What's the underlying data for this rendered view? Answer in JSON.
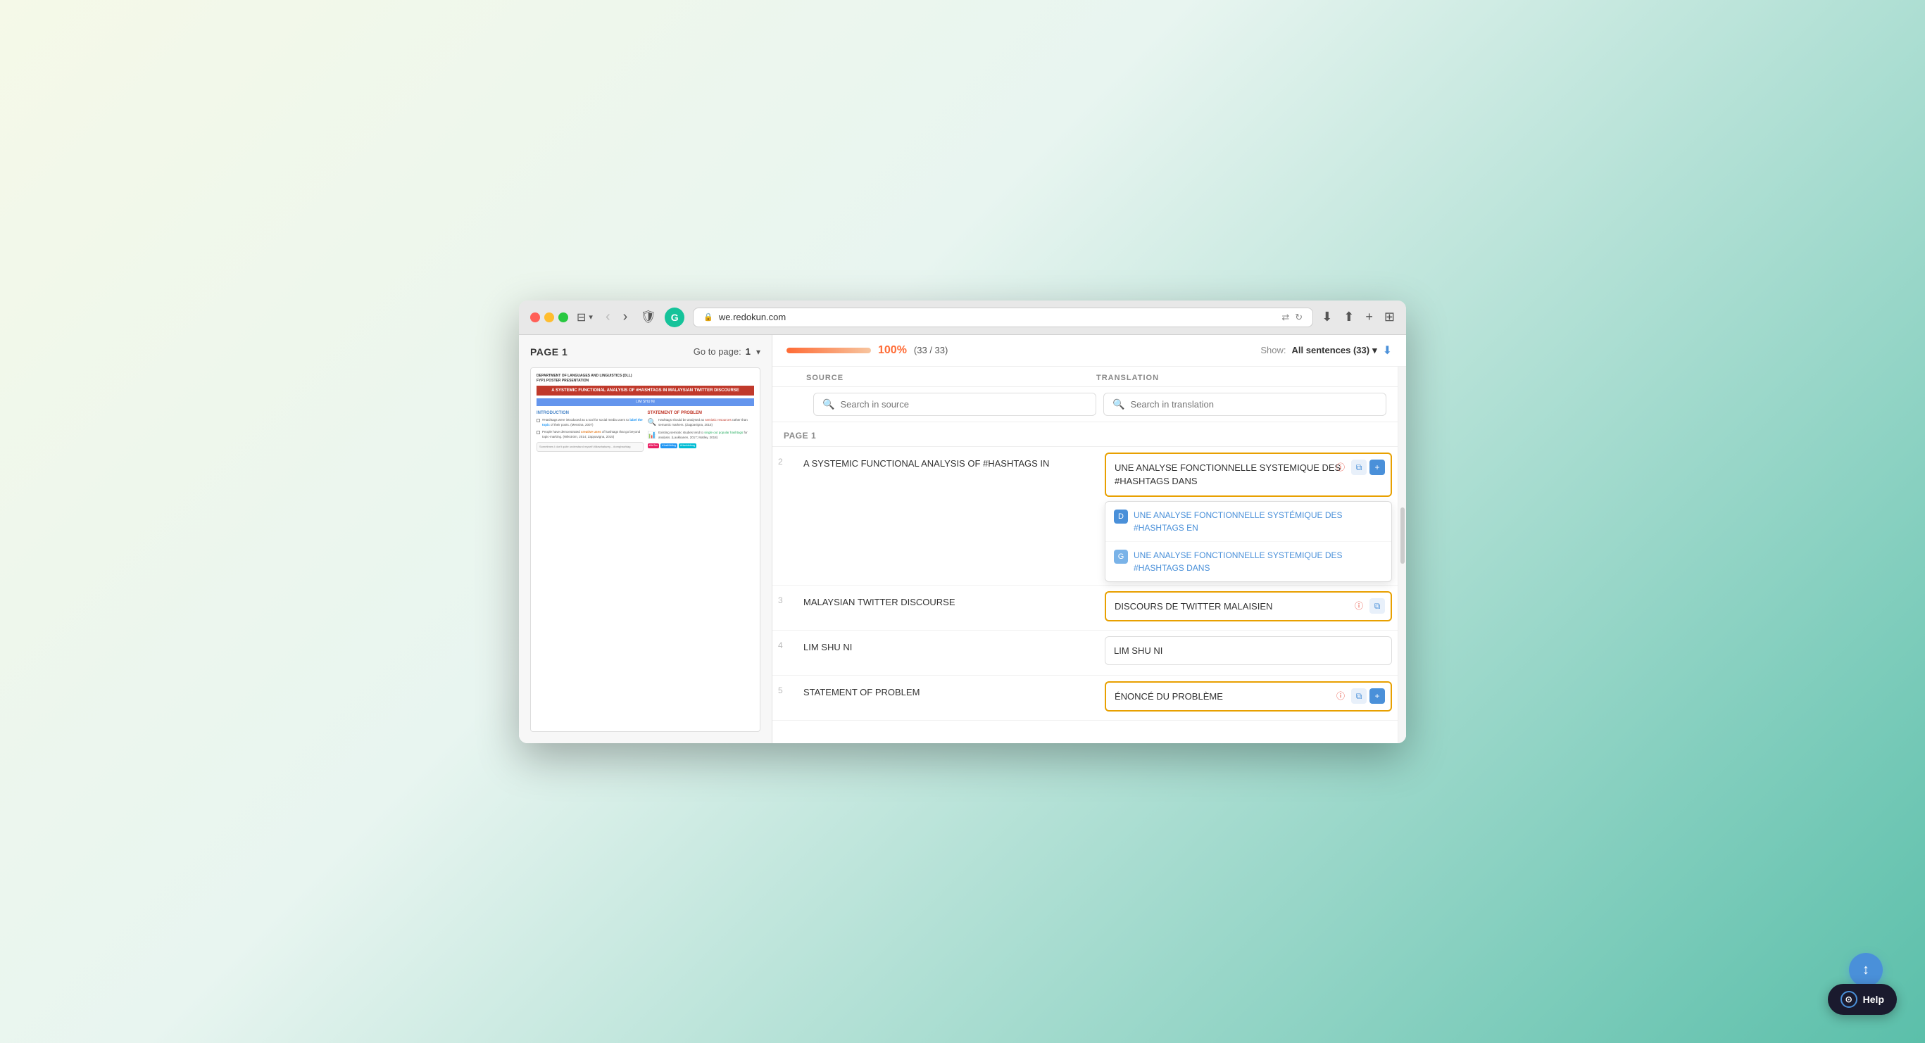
{
  "browser": {
    "url": "we.redokun.com",
    "tab_icon": "G",
    "shield": "shield-icon",
    "grammarly": "G",
    "nav_back": "‹",
    "nav_forward": "›",
    "lock_icon": "🔒",
    "translate_icon": "⇄",
    "refresh_icon": "↻",
    "download_icon": "↓",
    "share_icon": "↑",
    "add_tab_icon": "+",
    "grid_icon": "⊞"
  },
  "sidebar": {
    "page_title": "PAGE 1",
    "goto_label": "Go to page:",
    "page_number": "1",
    "doc": {
      "dept": "DEPARTMENT OF LANGUAGES AND LINGUISTICS (DLL)",
      "subtitle": "FYP1 POSTER PRESENTATION",
      "title": "A SYSTEMIC FUNCTIONAL ANALYSIS OF #HASHTAGS IN MALAYSIAN TWITTER DISCOURSE",
      "author": "LIM SHU NI",
      "intro_title": "INTRODUCTION",
      "problem_title": "STATEMENT OF PROBLEM",
      "intro_text1": "#Hashtags were introduced as a tool for social media users to label the topic of their posts. (Messina, 2007)",
      "intro_text2": "People have demonstrated creative uses of hashtags that go beyond topic-marking. (Wikström, 2014; Zappavigna, 2015)",
      "problem_text1": "Hashtags should be analysed as semiotic resources rather than semantic markers. (Zappavigna, 2015)",
      "problem_text2": "Existing semiotic studies tend to single out popular hashtags for analysis. (Laukkanen, 2017; Matley, 2018)",
      "bubble_text": "Sometimes I don't quite understand myself #likewhatarey oueverthinkingrightnow #omghashtag"
    }
  },
  "topbar": {
    "progress_pct": "100%",
    "progress_fraction": "(33 / 33)",
    "show_label": "Show:",
    "show_value": "All sentences (33)",
    "filter_icon": "⬇"
  },
  "columns": {
    "source_label": "SOURCE",
    "translation_label": "TRANSLATION"
  },
  "search": {
    "source_placeholder": "Search in source",
    "translation_placeholder": "Search in translation",
    "search_icon": "🔍"
  },
  "page_section": {
    "label": "PAGE 1"
  },
  "rows": [
    {
      "num": "2",
      "source": "A SYSTEMIC FUNCTIONAL ANALYSIS OF #HASHTAGS IN",
      "translation": "UNE ANALYSE FONCTIONNELLE SYSTEMIQUE DES #HASHTAGS DANS",
      "has_suggestions": true,
      "has_warning": true,
      "suggestions": [
        {
          "text": "UNE ANALYSE FONCTIONNELLE SYSTÉMIQUE DES #HASHTAGS EN",
          "type": "deepl"
        },
        {
          "text": "UNE ANALYSE FONCTIONNELLE SYSTEMIQUE DES #HASHTAGS DANS",
          "type": "google"
        }
      ]
    },
    {
      "num": "3",
      "source": "MALAYSIAN TWITTER DISCOURSE",
      "translation": "DISCOURS DE TWITTER MALAISIEN",
      "has_suggestions": false,
      "has_warning": true
    },
    {
      "num": "4",
      "source": "LIM SHU NI",
      "translation": "LIM SHU NI",
      "has_suggestions": false,
      "has_warning": false
    },
    {
      "num": "5",
      "source": "STATEMENT OF PROBLEM",
      "translation": "ÉNONCÉ DU PROBLÈME",
      "has_suggestions": false,
      "has_warning": true
    }
  ],
  "help": {
    "label": "Help",
    "icon": "?"
  },
  "icons": {
    "warning": "ⓘ",
    "copy": "⧉",
    "add": "+",
    "search": "⌕",
    "deepl": "D",
    "google": "G"
  }
}
